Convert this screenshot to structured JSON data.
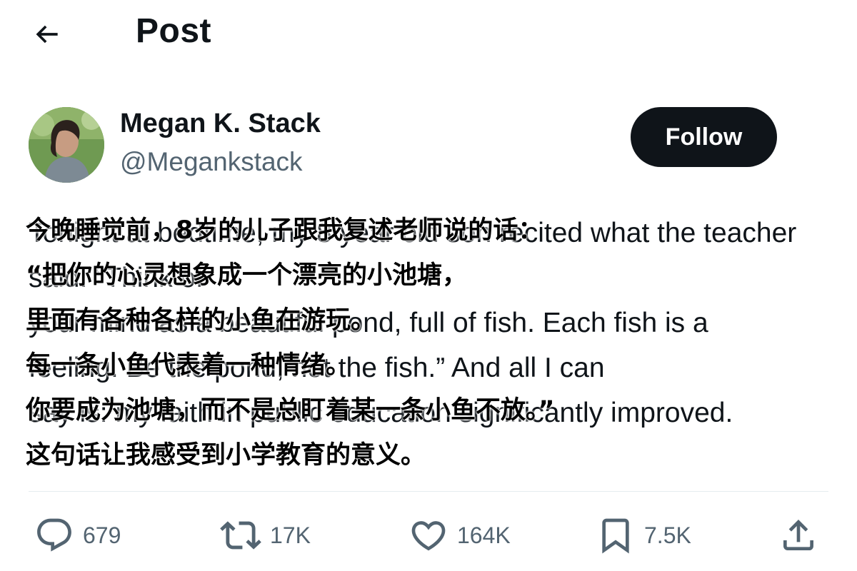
{
  "header": {
    "title": "Post"
  },
  "author": {
    "name": "Megan K. Stack",
    "handle": "@Megankstack",
    "follow_label": "Follow"
  },
  "tweet": {
    "english_lines": [
      "Tonight at bedtime, my 8 year old son recited what the teacher said: “Think of",
      "your mind as a beautiful pond, full of fish. Each fish is a",
      "feeling. Be the pond, not the fish.” And all I can",
      "say is: my faith in public education significantly improved."
    ],
    "chinese_lines": [
      "今晚睡觉前，8岁的儿子跟我复述老师说的话：",
      "“把你的心灵想象成一个漂亮的小池塘，",
      "里面有各种各样的小鱼在游玩。",
      "每一条小鱼代表着一种情绪。",
      "你要成为池塘，而不是总盯着某一条小鱼不放。”",
      "这句话让我感受到小学教育的意义。"
    ]
  },
  "actions": {
    "replies": "679",
    "reposts": "17K",
    "likes": "164K",
    "bookmarks": "7.5K"
  },
  "icons": {
    "back": "arrow-left-icon",
    "reply": "reply-icon",
    "repost": "repost-icon",
    "like": "heart-icon",
    "bookmark": "bookmark-icon",
    "share": "share-icon"
  },
  "colors": {
    "text": "#0f1419",
    "secondary": "#536471",
    "follow_bg": "#0f1419"
  }
}
